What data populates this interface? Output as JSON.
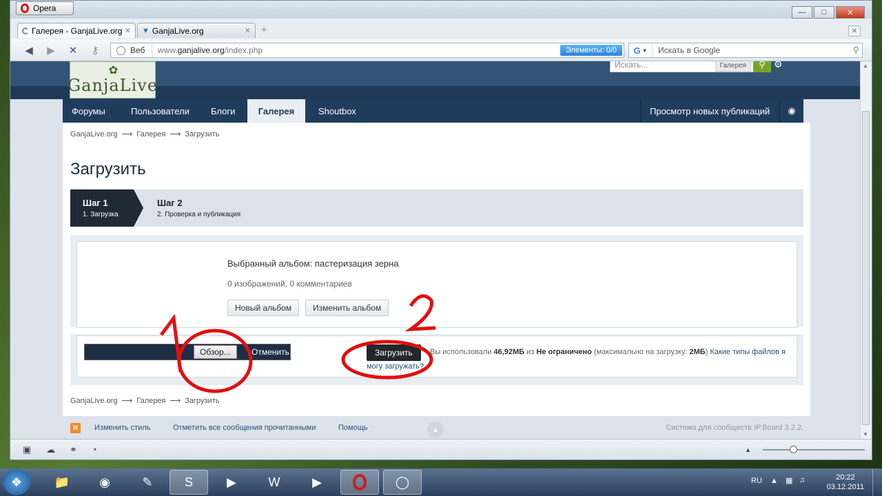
{
  "browser": {
    "opera_label": "Opera",
    "tabs": [
      {
        "label": "Галерея - GanjaLive.org"
      },
      {
        "label": "GanjaLive.org"
      }
    ],
    "address_scope": "Веб",
    "url_prefix": "www.",
    "url_domain": "ganjalive.org",
    "url_path": "/index.php",
    "elements_label": "Элементы:",
    "elements_count": "0/0",
    "search_placeholder": "Искать в Google"
  },
  "site": {
    "logo_text": "GanjaLive",
    "search_placeholder": "Искать...",
    "search_scope": "Галерея",
    "menu": [
      "Форумы",
      "Пользователи",
      "Блоги",
      "Галерея",
      "Shoutbox"
    ],
    "menu_right": "Просмотр новых публикаций"
  },
  "breadcrumb": [
    "GanjaLive.org",
    "Галерея",
    "Загрузить"
  ],
  "page": {
    "title": "Загрузить",
    "steps": [
      {
        "title": "Шаг 1",
        "subtitle": "1. Загрузка"
      },
      {
        "title": "Шаг 2",
        "subtitle": "2. Проверка и публикация"
      }
    ],
    "album": {
      "selected": "Выбранный альбом: пастеризация зерна",
      "stats": "0 изображений, 0 комментариев",
      "new_button": "Новый альбом",
      "change_button": "Изменить альбом"
    },
    "upload": {
      "browse_label": "Обзор...",
      "cancel_label": "Отменить",
      "upload_label": "Загрузить",
      "used_prefix": "Вы использовали",
      "used_value": "46,92МБ",
      "used_mid": "из",
      "limit": "Не ограничено",
      "max_prefix": "(максимально на загрузку:",
      "max_value": "2МБ",
      "max_suffix": ")",
      "types_link": "Какие типы файлов я",
      "types_link2": "могу загружать?"
    }
  },
  "footer": {
    "change_style": "Изменить стиль",
    "mark_read": "Отметить все сообщения прочитанными",
    "help": "Помощь",
    "system": "Система для сообществ IP.Board 3.2.2."
  },
  "taskbar": {
    "lang": "RU",
    "time": "20:22",
    "date": "03.12.2011"
  },
  "annotations": {
    "mark1": "1",
    "mark2": "2"
  },
  "colors": {
    "header": "#345476",
    "menu": "#203c5c",
    "accent_green": "#77a52a",
    "annotation": "#e11010"
  }
}
